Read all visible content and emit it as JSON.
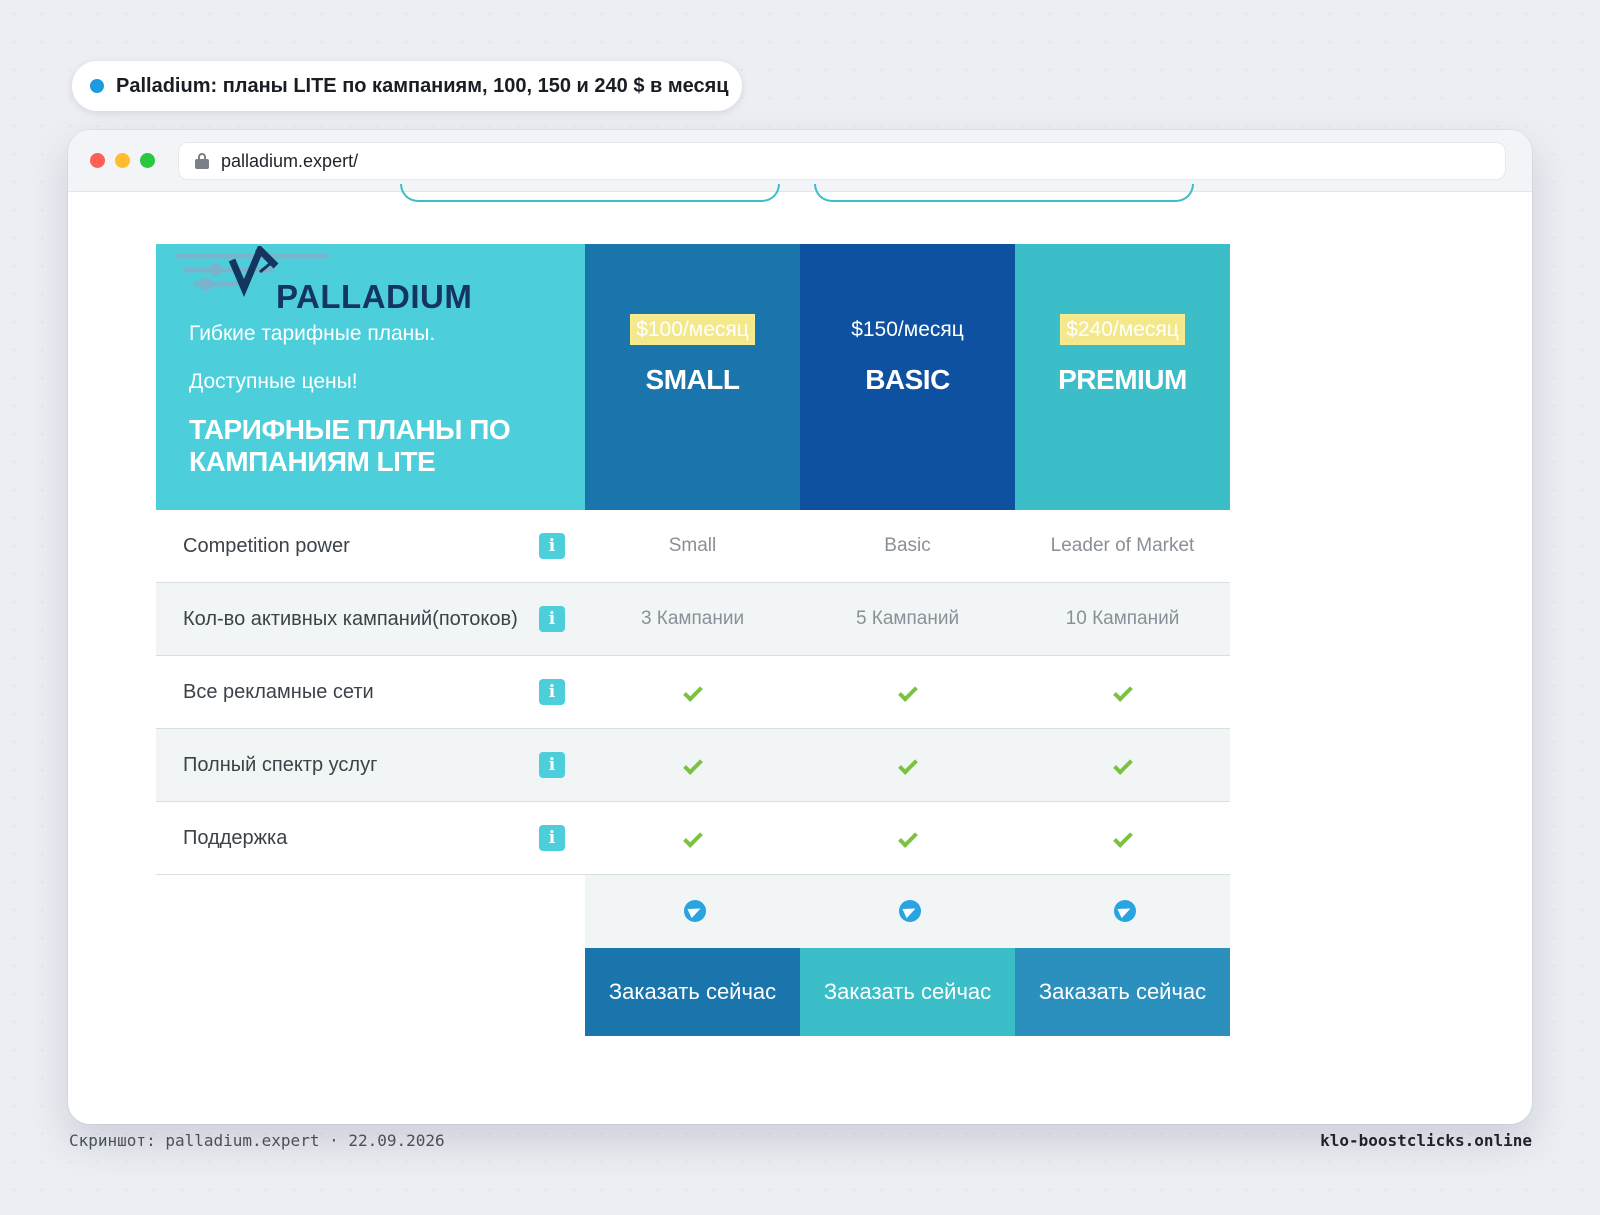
{
  "caption": {
    "text": "Palladium: планы LITE по кампаниям, 100, 150 и 240 $ в месяц",
    "dot_color": "#1e9be0"
  },
  "browser": {
    "url": "palladium.expert/"
  },
  "hero": {
    "logo_text": "PALLADIUM",
    "subtitle1": "Гибкие тарифные планы.",
    "subtitle2": "Доступные цены!",
    "title": "ТАРИФНЫЕ ПЛАНЫ ПО КАМПАНИЯМ LITE"
  },
  "plans": [
    {
      "price": "$100/месяц",
      "name": "SMALL",
      "color": "#1b75ad",
      "price_highlighted": true
    },
    {
      "price": "$150/месяц",
      "name": "BASIC",
      "color": "#0d51a0",
      "price_highlighted": false
    },
    {
      "price": "$240/месяц",
      "name": "PREMIUM",
      "color": "#3bbec8",
      "price_highlighted": true
    }
  ],
  "features": [
    {
      "label": "Competition power",
      "values": [
        "Small",
        "Basic",
        "Leader of Market"
      ]
    },
    {
      "label": "Кол-во активных кампаний(потоков)",
      "values": [
        "3 Кампании",
        "5 Кампаний",
        "10 Кампаний"
      ]
    },
    {
      "label": "Все рекламные сети",
      "values": [
        "check",
        "check",
        "check"
      ]
    },
    {
      "label": "Полный спектр услуг",
      "values": [
        "check",
        "check",
        "check"
      ]
    },
    {
      "label": "Поддержка",
      "values": [
        "check",
        "check",
        "check"
      ]
    }
  ],
  "order_buttons": [
    "Заказать сейчас",
    "Заказать сейчас",
    "Заказать сейчас"
  ],
  "footer": {
    "left": "Скриншот: palladium.expert · 22.09.2026",
    "right": "klo-boostclicks.online"
  },
  "colors": {
    "accent_cyan": "#4ccfdb",
    "check_green": "#7cc242",
    "telegram_blue": "#2aa3e1"
  },
  "icons": {
    "info": "info-icon",
    "check": "check-icon",
    "telegram": "telegram-icon",
    "lock": "lock-icon"
  }
}
